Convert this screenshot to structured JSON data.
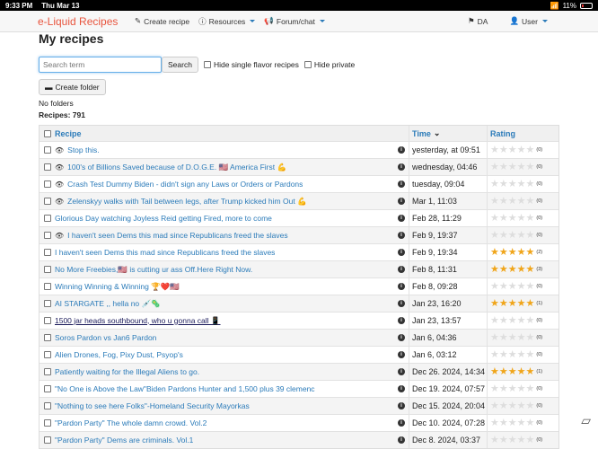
{
  "status": {
    "time": "9:33 PM",
    "date": "Thu Mar 13",
    "wifi": "wifi",
    "battery": "11%"
  },
  "nav": {
    "brand": "e-Liquid Recipes",
    "create": "Create recipe",
    "resources": "Resources",
    "forum": "Forum/chat",
    "lang": "DA",
    "user": "User"
  },
  "page": {
    "title": "My recipes"
  },
  "search": {
    "placeholder": "Search term",
    "button": "Search",
    "hide_single": "Hide single flavor recipes",
    "hide_private": "Hide private"
  },
  "folder": {
    "button": "Create folder",
    "none": "No folders",
    "count": "Recipes: 791"
  },
  "table": {
    "headers": {
      "recipe": "Recipe",
      "time": "Time",
      "rating": "Rating"
    },
    "rows": [
      {
        "name": "Stop this.",
        "eye": true,
        "time": "yesterday, at 09:51",
        "stars": 0,
        "count": "(0)"
      },
      {
        "name": "100's of Billions Saved because of D.O.G.E. 🇺🇸 America First 💪",
        "eye": true,
        "time": "wednesday, 04:46",
        "stars": 0,
        "count": "(0)"
      },
      {
        "name": "Crash Test Dummy Biden - didn't sign any Laws or Orders or Pardons",
        "eye": true,
        "time": "tuesday, 09:04",
        "stars": 0,
        "count": "(0)"
      },
      {
        "name": "Zelenskyy walks with Tail between legs, after Trump kicked him Out 💪",
        "eye": true,
        "time": "Mar 1, 11:03",
        "stars": 0,
        "count": "(0)"
      },
      {
        "name": "Glorious Day watching Joyless Reid getting Fired, more to come",
        "eye": false,
        "time": "Feb 28, 11:29",
        "stars": 0,
        "count": "(0)"
      },
      {
        "name": "I haven't seen Dems this mad since Republicans freed the slaves",
        "eye": true,
        "time": "Feb 9, 19:37",
        "stars": 0,
        "count": "(0)"
      },
      {
        "name": "I haven't seen Dems this mad since Republicans freed the slaves",
        "eye": false,
        "time": "Feb 9, 19:34",
        "stars": 5,
        "count": "(2)"
      },
      {
        "name": "No More Freebies,🇺🇸 is cutting ur ass Off.Here Right Now.",
        "eye": false,
        "time": "Feb 8, 11:31",
        "stars": 5,
        "count": "(3)"
      },
      {
        "name": "Winning Winning & Winning 🏆❤️🇺🇸",
        "eye": false,
        "time": "Feb 8, 09:28",
        "stars": 0,
        "count": "(0)"
      },
      {
        "name": "AI STARGATE ,, hella no 💉🦠",
        "eye": false,
        "time": "Jan 23, 16:20",
        "stars": 5,
        "count": "(1)"
      },
      {
        "name": "1500 jar heads southbound, who u gonna call 📱",
        "eye": false,
        "visited": true,
        "time": "Jan 23, 13:57",
        "stars": 0,
        "count": "(0)"
      },
      {
        "name": "Soros Pardon vs Jan6 Pardon",
        "eye": false,
        "time": "Jan 6, 04:36",
        "stars": 0,
        "count": "(0)"
      },
      {
        "name": "Alien Drones, Fog, Pixy Dust, Psyop's",
        "eye": false,
        "time": "Jan 6, 03:12",
        "stars": 0,
        "count": "(0)"
      },
      {
        "name": "Patiently waiting for the Illegal Aliens to go.",
        "eye": false,
        "time": "Dec 26. 2024, 14:34",
        "stars": 5,
        "count": "(1)"
      },
      {
        "name": "\"No One is Above the Law\"Biden Pardons Hunter and 1,500 plus 39 clemenc",
        "eye": false,
        "time": "Dec 19. 2024, 07:57",
        "stars": 0,
        "count": "(0)"
      },
      {
        "name": "\"Nothing to see here Folks\"-Homeland Security Mayorkas",
        "eye": false,
        "time": "Dec 15. 2024, 20:04",
        "stars": 0,
        "count": "(0)"
      },
      {
        "name": "\"Pardon Party\" The whole damn crowd. Vol.2",
        "eye": false,
        "time": "Dec 10. 2024, 07:28",
        "stars": 0,
        "count": "(0)"
      },
      {
        "name": "\"Pardon Party\" Dems are criminals. Vol.1",
        "eye": false,
        "time": "Dec 8. 2024, 03:37",
        "stars": 0,
        "count": "(0)"
      }
    ]
  }
}
